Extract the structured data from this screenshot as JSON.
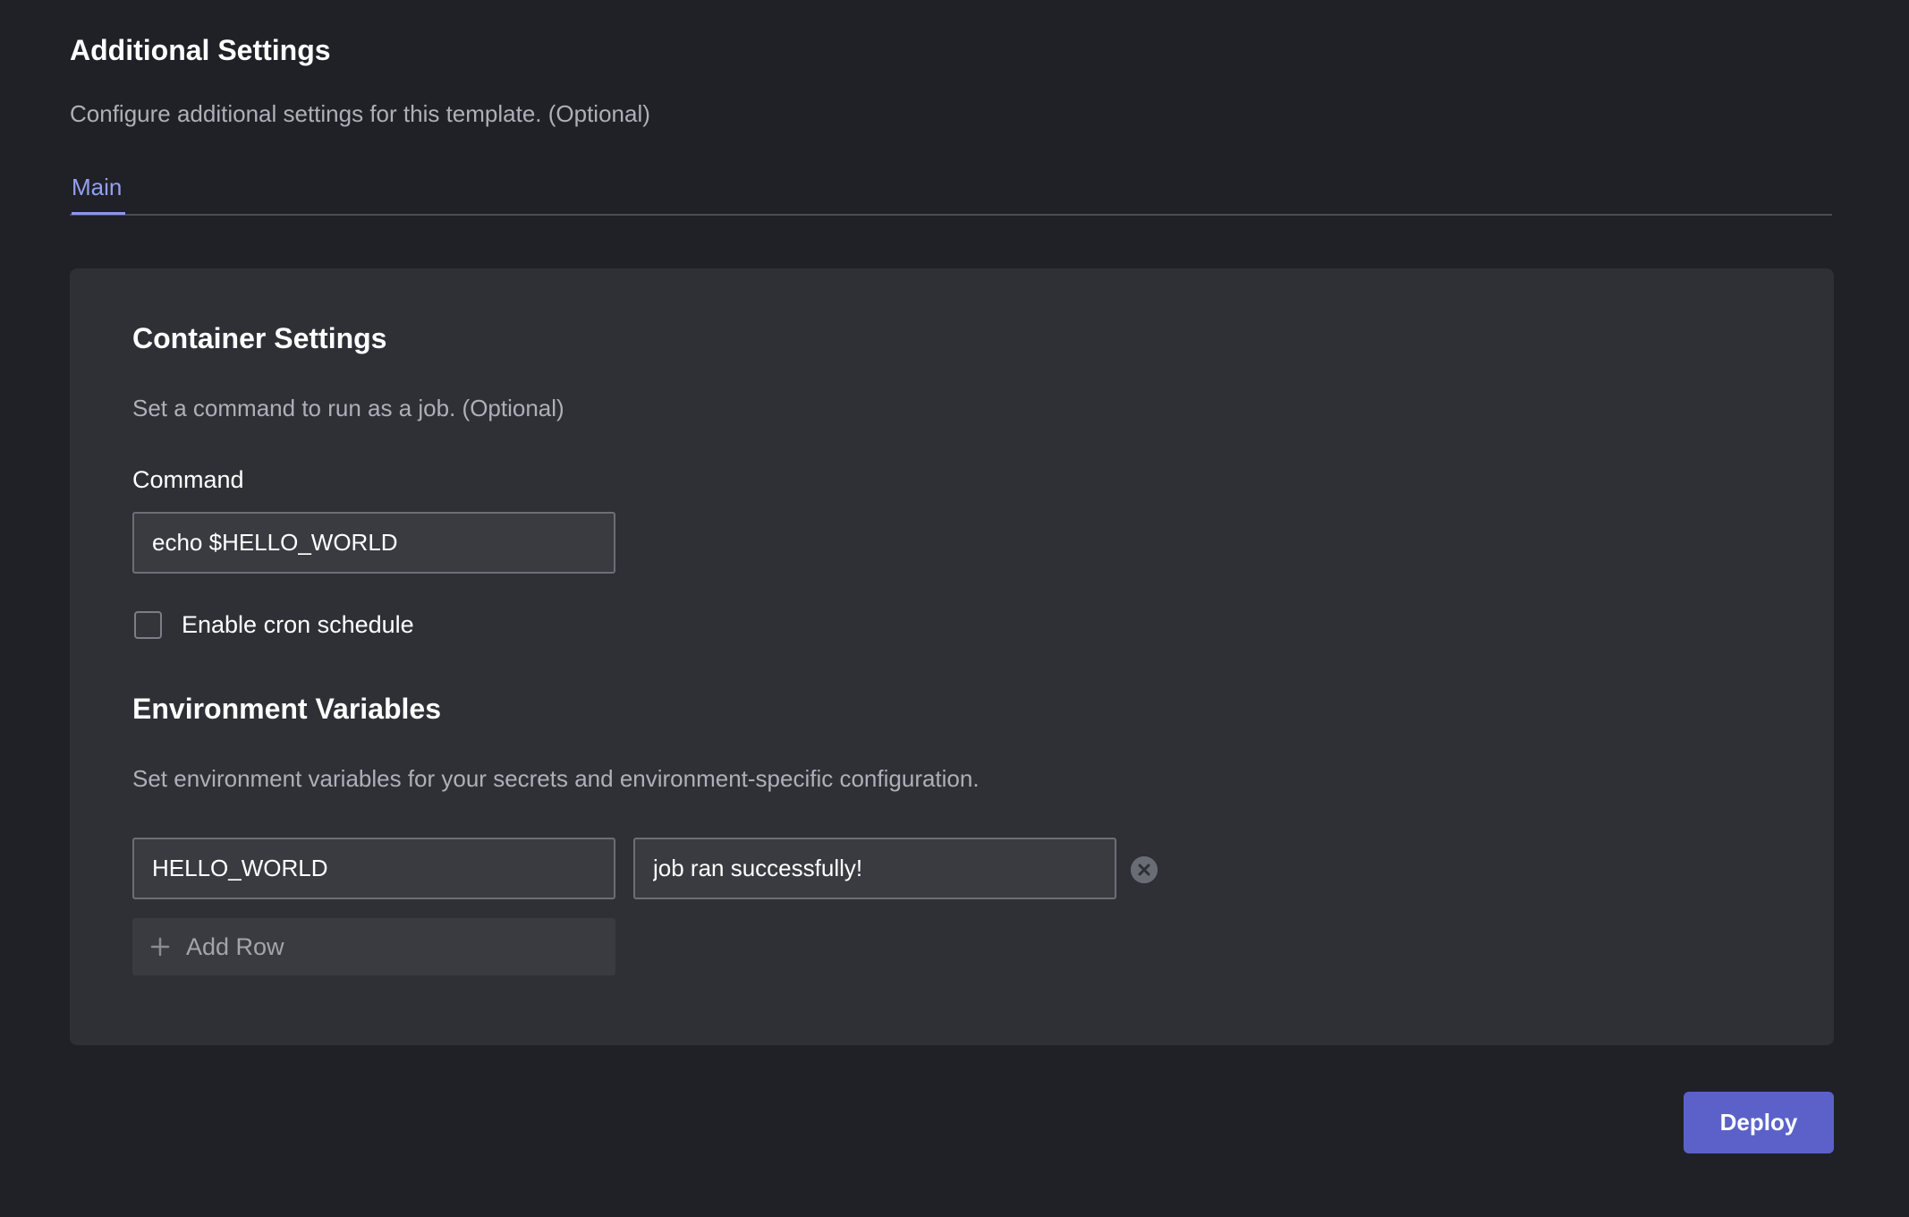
{
  "header": {
    "title": "Additional Settings",
    "subtitle": "Configure additional settings for this template. (Optional)"
  },
  "tabs": [
    {
      "label": "Main",
      "active": true
    }
  ],
  "container_settings": {
    "title": "Container Settings",
    "description": "Set a command to run as a job. (Optional)",
    "command_label": "Command",
    "command_value": "echo $HELLO_WORLD",
    "cron_label": "Enable cron schedule",
    "cron_enabled": false
  },
  "environment": {
    "title": "Environment Variables",
    "description": "Set environment variables for your secrets and environment-specific configuration.",
    "rows": [
      {
        "key": "HELLO_WORLD",
        "value": "job ran successfully!"
      }
    ],
    "add_row_label": "Add Row"
  },
  "actions": {
    "deploy_label": "Deploy"
  },
  "colors": {
    "background": "#202127",
    "card": "#2f3036",
    "accent": "#5b61c9",
    "tab_active": "#949ff5"
  },
  "icons": {
    "remove_row": "close-circle-icon",
    "add_row": "plus-icon"
  }
}
